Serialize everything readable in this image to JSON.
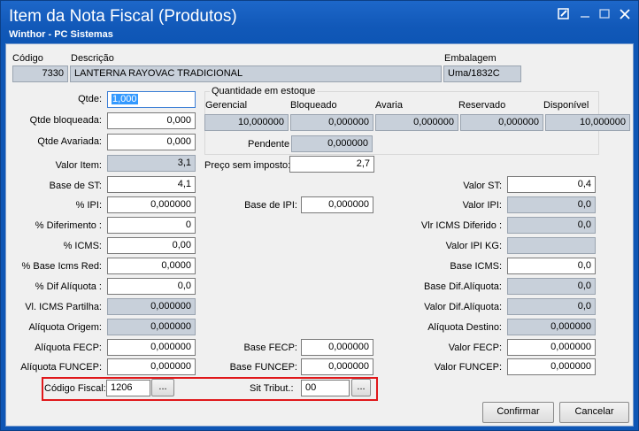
{
  "window": {
    "title": "Item da Nota Fiscal (Produtos)",
    "subtitle": "Winthor - PC Sistemas"
  },
  "header": {
    "codigo_label": "Código",
    "codigo_value": "7330",
    "descricao_label": "Descrição",
    "descricao_value": "LANTERNA RAYOVAC TRADICIONAL",
    "embalagem_label": "Embalagem",
    "embalagem_value": "Uma/1832C"
  },
  "qty": {
    "qtde_label": "Qtde:",
    "qtde_value": "1,000",
    "bloqueada_label": "Qtde bloqueada:",
    "bloqueada_value": "0,000",
    "avariada_label": "Qtde Avariada:",
    "avariada_value": "0,000"
  },
  "stock": {
    "legend": "Quantidade em estoque",
    "gerencial_label": "Gerencial",
    "gerencial_value": "10,000000",
    "bloqueado_label": "Bloqueado",
    "bloqueado_value": "0,000000",
    "avaria_label": "Avaria",
    "avaria_value": "0,000000",
    "reservado_label": "Reservado",
    "reservado_value": "0,000000",
    "disponivel_label": "Disponível",
    "disponivel_value": "10,000000",
    "pendente_label": "Pendente",
    "pendente_value": "0,000000"
  },
  "left": {
    "valor_item_label": "Valor Item:",
    "valor_item_value": "3,1",
    "base_st_label": "Base de ST:",
    "base_st_value": "4,1",
    "ipi_label": "% IPI:",
    "ipi_value": "0,000000",
    "diferimento_label": "%  Diferimento :",
    "diferimento_value": "0",
    "icms_label": "% ICMS:",
    "icms_value": "0,00",
    "base_icms_red_label": "% Base Icms Red:",
    "base_icms_red_value": "0,0000",
    "dif_aliquota_label": "% Dif Alíquota :",
    "dif_aliquota_value": "0,0",
    "icms_partilha_label": "Vl. ICMS Partilha:",
    "icms_partilha_value": "0,000000",
    "aliquota_origem_label": "Alíquota Origem:",
    "aliquota_origem_value": "0,000000",
    "aliquota_fecp_label": "Alíquota FECP:",
    "aliquota_fecp_value": "0,000000",
    "aliquota_funcep_label": "Alíquota FUNCEP:",
    "aliquota_funcep_value": "0,000000",
    "codigo_fiscal_label": "Código Fiscal:",
    "codigo_fiscal_value": "1206"
  },
  "middle": {
    "preco_label": "Preço sem imposto:",
    "preco_value": "2,7",
    "base_ipi_label": "Base de IPI:",
    "base_ipi_value": "0,000000",
    "base_fecp_label": "Base FECP:",
    "base_fecp_value": "0,000000",
    "base_funcep_label": "Base FUNCEP:",
    "base_funcep_value": "0,000000",
    "sit_tribut_label": "Sit Tribut.:",
    "sit_tribut_value": "00"
  },
  "right": {
    "valor_st_label": "Valor ST:",
    "valor_st_value": "0,4",
    "valor_ipi_label": "Valor IPI:",
    "valor_ipi_value": "0,0",
    "icms_diferido_label": "Vlr ICMS Diferido :",
    "icms_diferido_value": "0,0",
    "ipi_kg_label": "Valor IPI KG:",
    "ipi_kg_value": "",
    "base_icms_label": "Base ICMS:",
    "base_icms_value": "0,0",
    "base_dif_aliquota_label": "Base Dif.Alíquota:",
    "base_dif_aliquota_value": "0,0",
    "valor_dif_aliquota_label": "Valor Dif.Alíquota:",
    "valor_dif_aliquota_value": "0,0",
    "aliquota_destino_label": "Alíquota Destino:",
    "aliquota_destino_value": "0,000000",
    "valor_fecp_label": "Valor FECP:",
    "valor_fecp_value": "0,000000",
    "valor_funcep_label": "Valor FUNCEP:",
    "valor_funcep_value": "0,000000"
  },
  "buttons": {
    "ellipsis": "...",
    "confirmar": "Confirmar",
    "cancelar": "Cancelar"
  },
  "colors": {
    "titlebar": "#1158b8",
    "highlight": "#e0181b",
    "readonly": "#c8d0da"
  }
}
